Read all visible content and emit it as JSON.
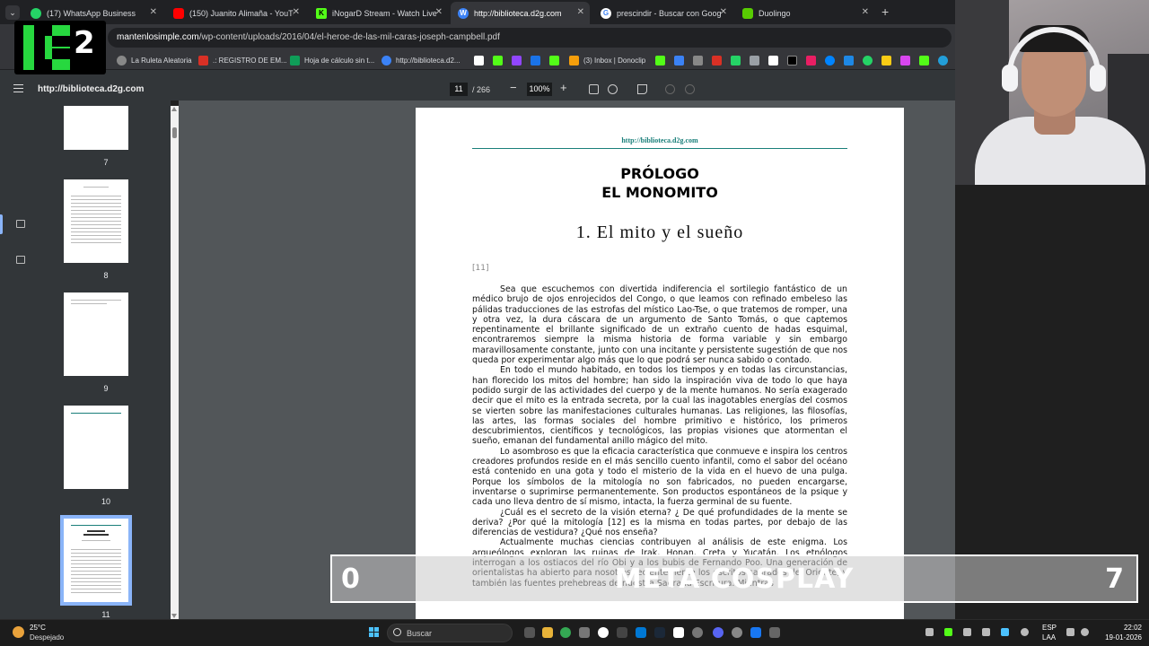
{
  "browser": {
    "tabs": [
      {
        "title": "(17) WhatsApp Business",
        "color": "#25d366"
      },
      {
        "title": "(150) Juanito Alimaña - YouTube",
        "color": "#ff0000"
      },
      {
        "title": "iNogarD Stream - Watch Live on",
        "color": "#53fc18"
      },
      {
        "title": "http://biblioteca.d2g.com",
        "color": "#3b82f6"
      },
      {
        "title": "prescindir - Buscar con Google",
        "color": "#ffffff"
      },
      {
        "title": "Duolingo",
        "color": "#58cc02"
      }
    ],
    "new_tab": "+",
    "url_domain": "mantenlosimple.com",
    "url_path": "/wp-content/uploads/2016/04/el-heroe-de-las-mil-caras-joseph-campbell.pdf",
    "bookmarks": [
      {
        "label": "La Ruleta Aleatoria",
        "color": "#888888"
      },
      {
        "label": ".: REGISTRO DE EM...",
        "color": "#d93025"
      },
      {
        "label": "Hoja de cálculo sin t...",
        "color": "#0f9d58"
      },
      {
        "label": "http://biblioteca.d2...",
        "color": "#3b82f6"
      },
      {
        "label": "(3) Inbox | Donoclip",
        "color": "#f59e0b"
      }
    ]
  },
  "pdf": {
    "title": "http://biblioteca.d2g.com",
    "page_current": "11",
    "page_total": "/ 266",
    "zoom_out": "−",
    "zoom": "100%",
    "zoom_in": "+",
    "thumbnails": [
      "7",
      "8",
      "9",
      "10",
      "11"
    ],
    "page": {
      "header": "http://biblioteca.d2g.com",
      "heading_1": "PRÓLOGO",
      "heading_2": "EL MONOMITO",
      "section": "1. El mito y el sueño",
      "page_ref": "[11]",
      "paragraphs": [
        "Sea que escuchemos con divertida indiferencia el sortilegio fantástico de un médico brujo de ojos enrojecidos del Congo, o que leamos con refinado embeleso las pálidas traducciones de las estrofas del místico Lao-Tse, o que tratemos de romper, una y otra vez, la dura cáscara de un argumento de Santo Tomás, o que captemos repentinamente el brillante significado de un extraño cuento de hadas esquimal, encontraremos siempre la misma historia de forma variable y sin embargo maravillosamente constante, junto con una incitante y persistente sugestión de que nos queda por experimentar algo más que lo que podrá ser nunca sabido o contado.",
        "En todo el mundo habitado, en todos los tiempos y en todas las circunstancias, han florecido los mitos del hombre; han sido la inspiración viva de todo lo que haya podido surgir de las actividades del cuerpo y de la mente humanos. No sería exagerado decir que el mito es la entrada secreta, por la cual las inagotables energías del cosmos se vierten sobre las manifestaciones culturales humanas. Las religiones, las filosofías, las artes, las formas sociales del hombre primitivo e histórico, los primeros descubrimientos, científicos y tecnológicos, las propias visiones que atormentan el sueño, emanan del fundamental anillo mágico del mito.",
        "Lo asombroso es que la eficacia característica que conmueve e inspira los centros creadores profundos reside en el más sencillo cuento infantil, como el sabor del océano está contenido en una gota y todo el misterio de la vida en el huevo de una pulga. Porque los símbolos de la mitología no son fabricados, no pueden encargarse, inventarse o suprimirse permanentemente. Son productos espontáneos de la psique y cada uno lleva dentro de sí mismo, intacta, la fuerza germinal de su fuente.",
        "¿Cuál es el secreto de la visión eterna? ¿ De qué profundidades de la mente se deriva? ¿Por qué la mitología [12] es la misma en todas partes, por debajo de las diferencias de vestidura? ¿Qué nos enseña?",
        "Actualmente muchas ciencias contribuyen al análisis de este enigma. Los arqueólogos exploran las ruinas de Irak, Honan, Creta y Yucatán. Los etnólogos interrogan a los ostiacos del río Obi y a los bubis de Fernando Poo. Una generación de orientalistas ha abierto para nosotros recientemente los escritos sagrados del Oriente, y también las fuentes prehebreas de nuestra Sagrada Escritura. Mientras"
      ]
    }
  },
  "taskbar": {
    "temperature": "25°C",
    "weather": "Despejado",
    "search": "Buscar",
    "lang": "ESP",
    "layout": "LAA",
    "time": "22:02",
    "date": "19-01-2026"
  },
  "overlay": {
    "logo_text": "2",
    "score_left": "0",
    "score_title": "META COSPLAY",
    "score_right": "7"
  }
}
